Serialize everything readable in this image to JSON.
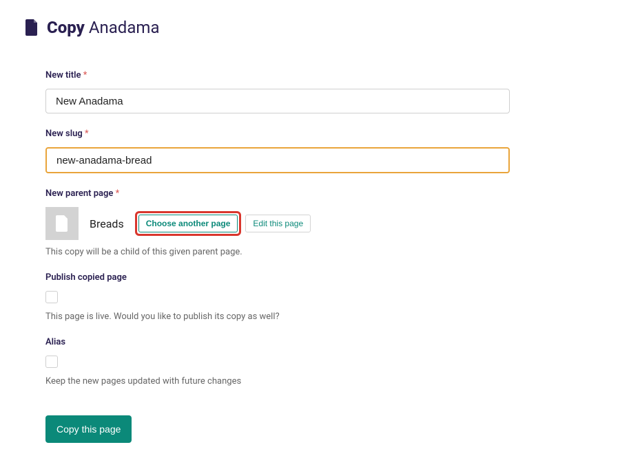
{
  "header": {
    "action": "Copy",
    "page_name": "Anadama"
  },
  "fields": {
    "new_title": {
      "label": "New title",
      "required": "*",
      "value": "New Anadama"
    },
    "new_slug": {
      "label": "New slug",
      "required": "*",
      "value": "new-anadama-bread"
    },
    "parent": {
      "label": "New parent page",
      "required": "*",
      "name": "Breads",
      "choose_btn": "Choose another page",
      "edit_btn": "Edit this page",
      "helper": "This copy will be a child of this given parent page."
    },
    "publish": {
      "label": "Publish copied page",
      "helper": "This page is live. Would you like to publish its copy as well?"
    },
    "alias": {
      "label": "Alias",
      "helper": "Keep the new pages updated with future changes"
    }
  },
  "submit": "Copy this page"
}
